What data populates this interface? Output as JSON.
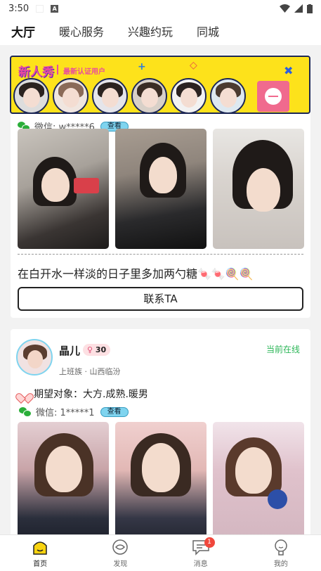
{
  "status_bar": {
    "time": "3:50"
  },
  "tabs": [
    {
      "label": "大厅",
      "active": true
    },
    {
      "label": "暖心服务",
      "active": false
    },
    {
      "label": "兴趣约玩",
      "active": false
    },
    {
      "label": "同城",
      "active": false
    }
  ],
  "banner": {
    "title": "新人秀",
    "subtitle": "最新认证用户",
    "avatar_count": 6
  },
  "card1": {
    "wechat_label": "微信: w*****6",
    "view_label": "查看",
    "motto": "在白开水一样淡的日子里多加两勺糖🍬🍬🍭🍭",
    "contact_label": "联系TA"
  },
  "card2": {
    "name": "晶儿",
    "age": "30",
    "online_status": "当前在线",
    "meta": "上班族 · 山西临汾",
    "wish": "期望对象：大方.成熟.暖男",
    "wechat_label": "微信: 1*****1",
    "view_label": "查看"
  },
  "bottom_nav": [
    {
      "label": "首页",
      "icon": "home-icon",
      "active": true
    },
    {
      "label": "发现",
      "icon": "discover-icon",
      "active": false
    },
    {
      "label": "消息",
      "icon": "message-icon",
      "active": false,
      "badge": "1"
    },
    {
      "label": "我的",
      "icon": "profile-icon",
      "active": false
    }
  ],
  "colors": {
    "accent": "#f8d310",
    "online": "#2bb657",
    "banner_bg": "#fde21b",
    "badge": "#f0473c"
  }
}
